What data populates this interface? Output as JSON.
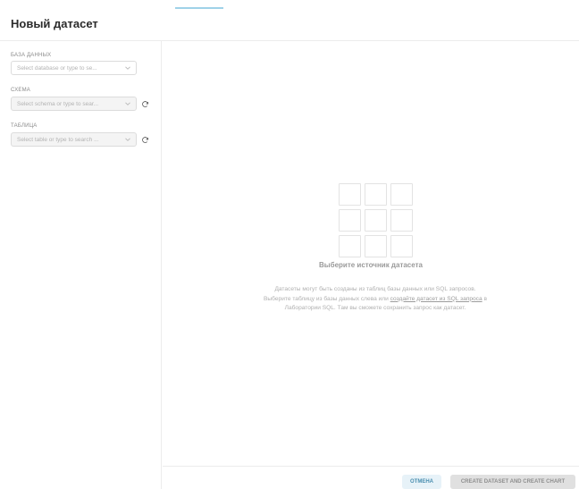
{
  "header": {
    "title": "Новый датасет"
  },
  "sidebar": {
    "database": {
      "label": "База данных",
      "placeholder": "Select database or type to se..."
    },
    "schema": {
      "label": "Схема",
      "placeholder": "Select schema or type to sear..."
    },
    "table": {
      "label": "Таблица",
      "placeholder": "Select table or type to search ..."
    }
  },
  "empty_state": {
    "title": "Выберите источник датасета",
    "desc_part1": "Датасеты могут быть созданы из таблиц базы данных или SQL запросов. Выберите таблицу из базы данных слева или ",
    "desc_link": "создайте датасет из SQL запроса",
    "desc_part2": " в Лаборатории SQL. Там вы сможете сохранить запрос как датасет."
  },
  "footer": {
    "cancel_label": "ОТМЕНА",
    "create_label": "CREATE DATASET AND CREATE CHART"
  },
  "icons": {
    "chevron": "chevron-down-icon",
    "refresh": "refresh-icon",
    "grid": "table-grid-icon"
  },
  "colors": {
    "accent": "#4b8fb0",
    "cancel_bg": "#e7f2f8",
    "disabled_bg": "#e0e0e0"
  }
}
